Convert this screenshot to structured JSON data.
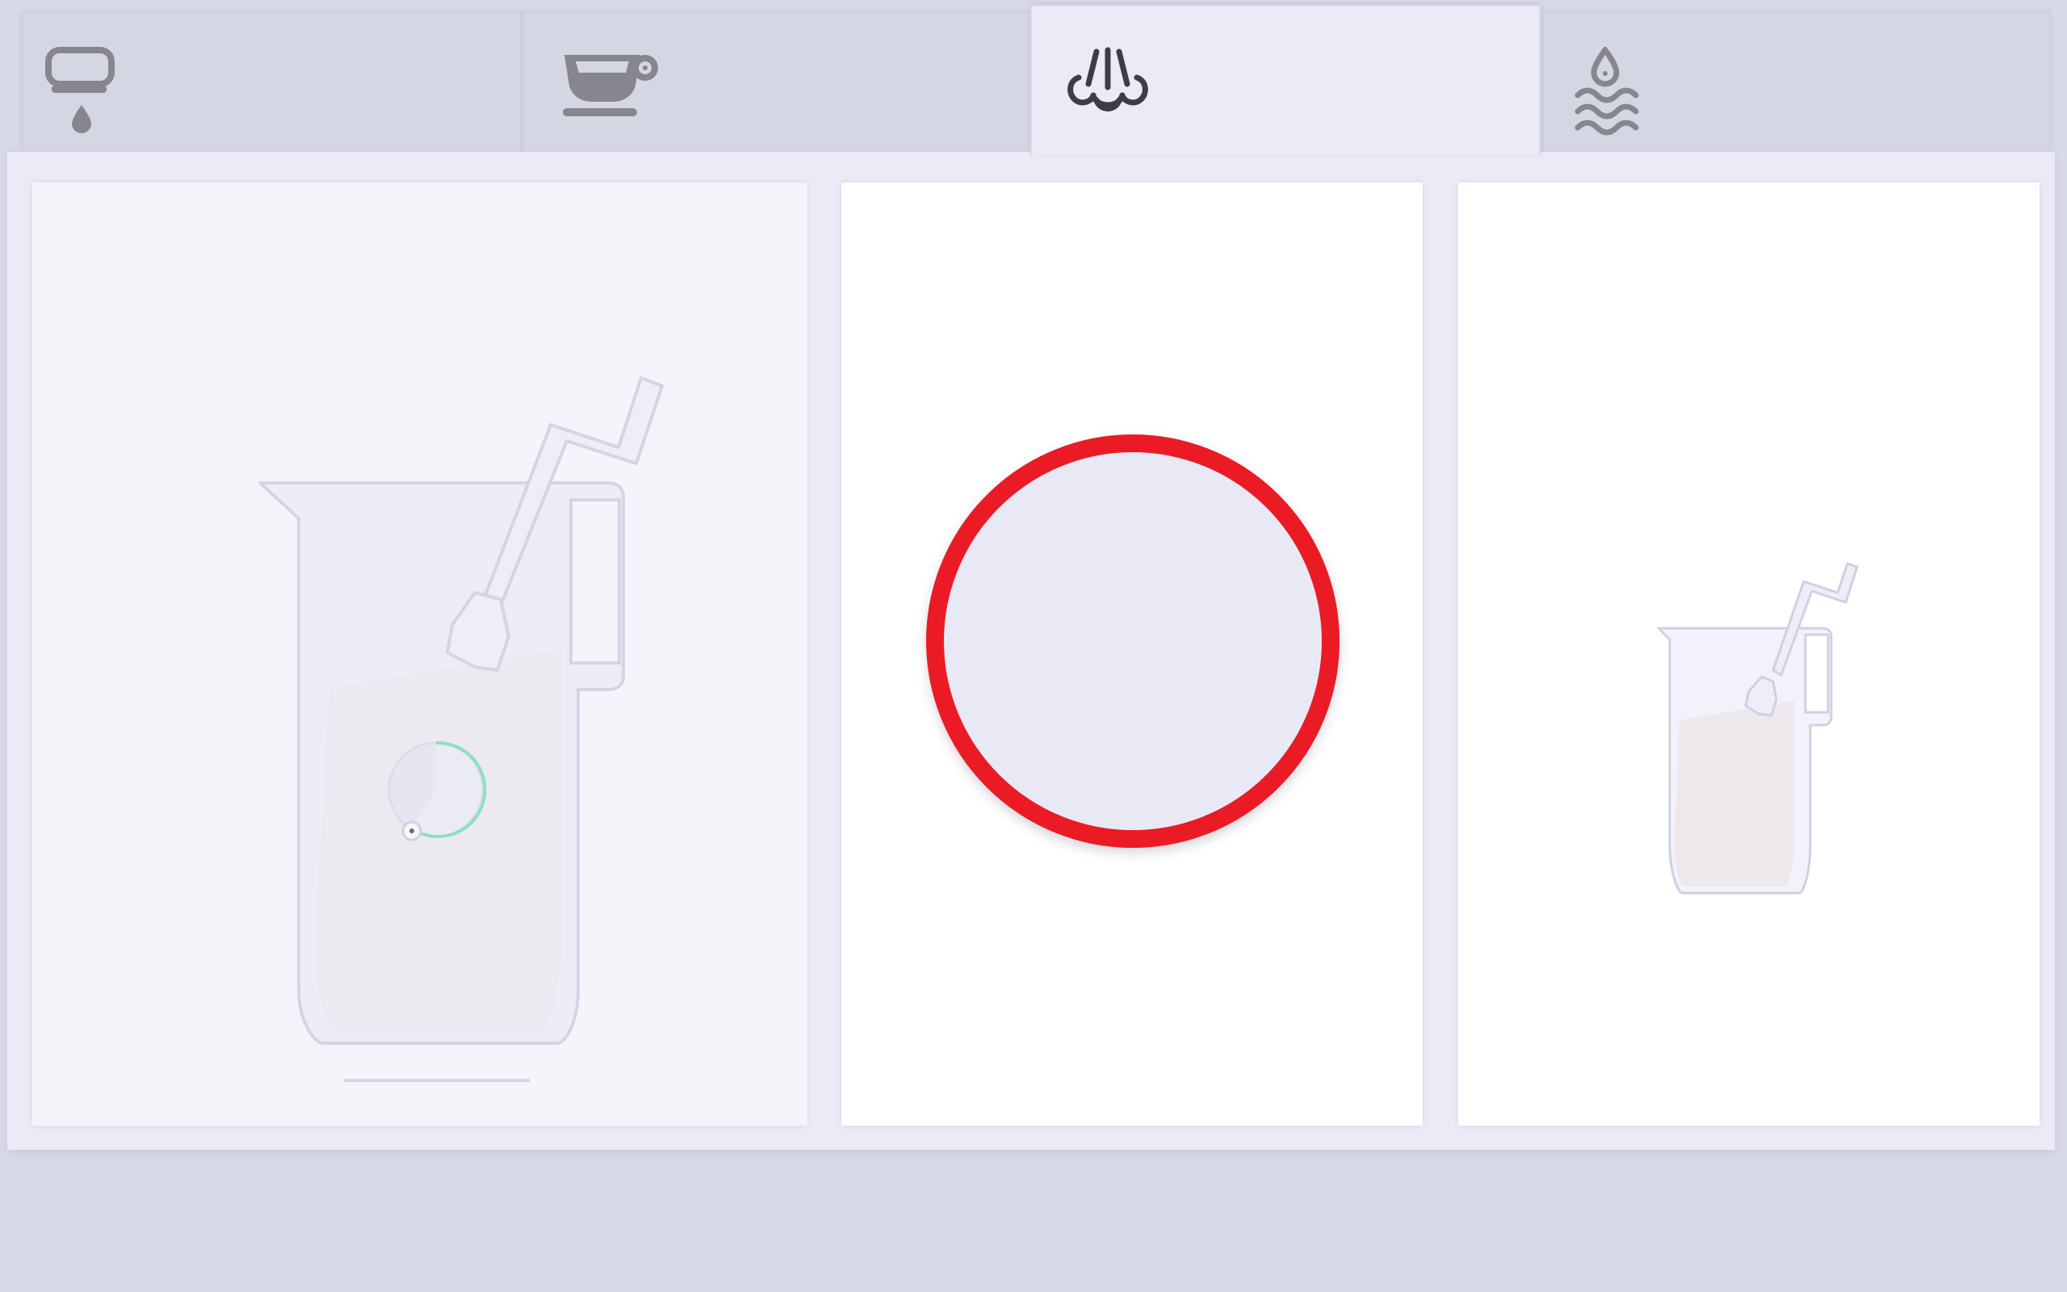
{
  "tabs": [
    {
      "id": "dispense",
      "icon": "dispense-drip-icon",
      "selected": false
    },
    {
      "id": "coffee",
      "icon": "coffee-cup-icon",
      "selected": false
    },
    {
      "id": "steam",
      "icon": "steam-icon",
      "selected": true
    },
    {
      "id": "hot-water",
      "icon": "hot-water-icon",
      "selected": false
    }
  ],
  "panels": {
    "left": {
      "illustration": "milk-pitcher-with-steam-wand-icon",
      "timer_icon": "timer-icon",
      "progress": 0.4
    },
    "middle": {
      "button": "start-steam-button"
    },
    "right": {
      "illustration": "small-milk-pitcher-icon"
    }
  },
  "colors": {
    "accent_red": "#eb1b25",
    "timer_green": "#8ee0bf",
    "milk": "#efe6dc",
    "tab_selected": "#ebebf7",
    "tab_unselected": "#d5d6e4",
    "icon_gray": "#86868f",
    "icon_dark": "#3d3d45"
  }
}
